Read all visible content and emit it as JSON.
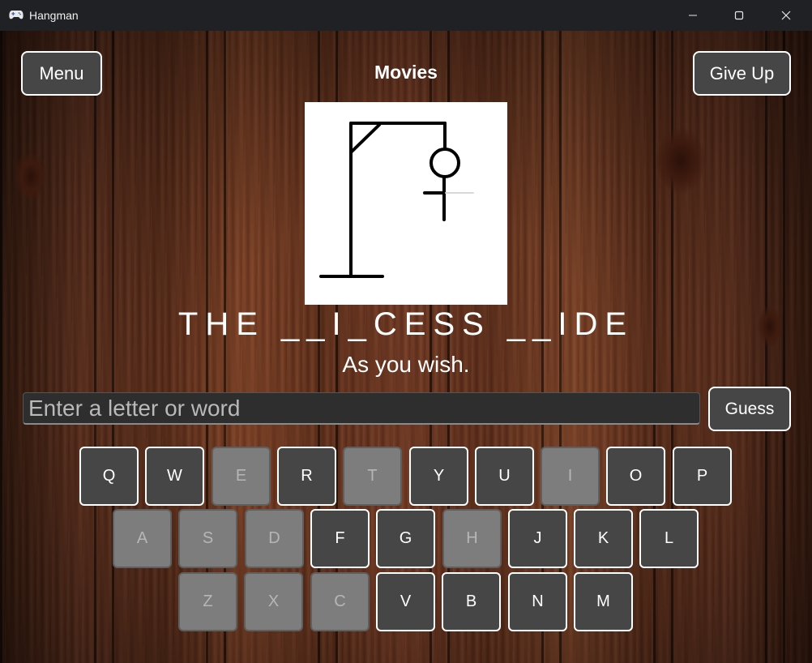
{
  "window": {
    "title": "Hangman",
    "app_icon": "gamepad-icon"
  },
  "controls": {
    "minimize": "minimize-icon",
    "maximize": "maximize-icon",
    "close": "close-icon"
  },
  "header": {
    "category": "Movies",
    "menu_label": "Menu",
    "give_up_label": "Give Up"
  },
  "puzzle": {
    "word": "THE __I_CESS __IDE",
    "hint": "As you wish."
  },
  "guess": {
    "placeholder": "Enter a letter or word",
    "value": "",
    "button_label": "Guess"
  },
  "keyboard": {
    "rows": [
      [
        {
          "letter": "Q",
          "used": false
        },
        {
          "letter": "W",
          "used": false
        },
        {
          "letter": "E",
          "used": true
        },
        {
          "letter": "R",
          "used": false
        },
        {
          "letter": "T",
          "used": true
        },
        {
          "letter": "Y",
          "used": false
        },
        {
          "letter": "U",
          "used": false
        },
        {
          "letter": "I",
          "used": true
        },
        {
          "letter": "O",
          "used": false
        },
        {
          "letter": "P",
          "used": false
        }
      ],
      [
        {
          "letter": "A",
          "used": true
        },
        {
          "letter": "S",
          "used": true
        },
        {
          "letter": "D",
          "used": true
        },
        {
          "letter": "F",
          "used": false
        },
        {
          "letter": "G",
          "used": false
        },
        {
          "letter": "H",
          "used": true
        },
        {
          "letter": "J",
          "used": false
        },
        {
          "letter": "K",
          "used": false
        },
        {
          "letter": "L",
          "used": false
        }
      ],
      [
        {
          "letter": "Z",
          "used": true
        },
        {
          "letter": "X",
          "used": true
        },
        {
          "letter": "C",
          "used": true
        },
        {
          "letter": "V",
          "used": false
        },
        {
          "letter": "B",
          "used": false
        },
        {
          "letter": "N",
          "used": false
        },
        {
          "letter": "M",
          "used": false
        }
      ]
    ]
  },
  "colors": {
    "key_active_bg": "#464646",
    "key_used_bg": "#7d7d7d",
    "border": "#ffffff"
  }
}
